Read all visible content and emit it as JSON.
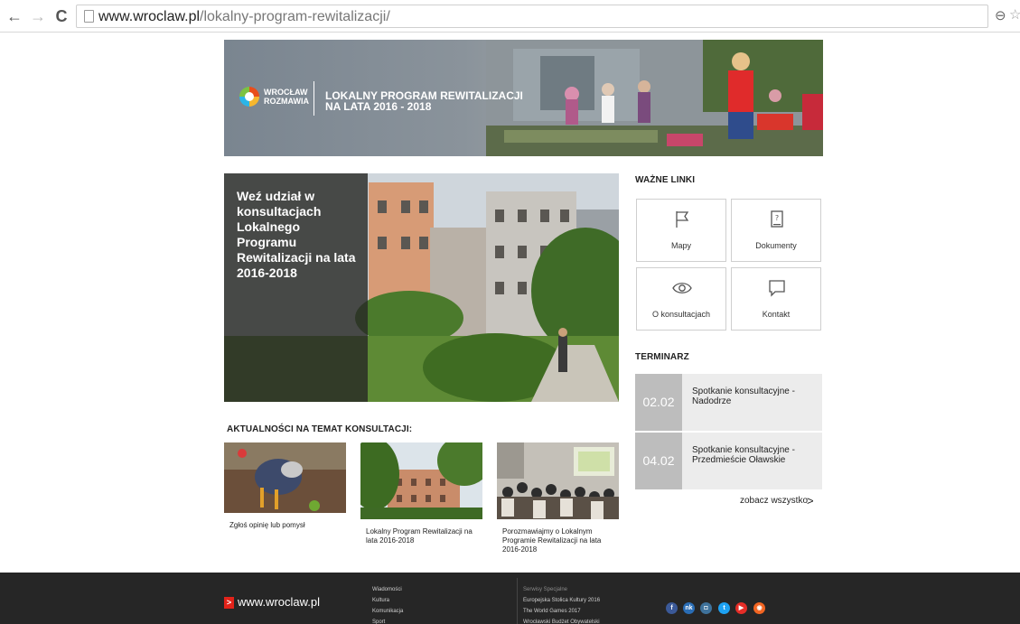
{
  "browser": {
    "url_host": "www.wroclaw.pl",
    "url_path": "/lokalny-program-rewitalizacji/"
  },
  "banner": {
    "logo_line1": "WROCŁAW",
    "logo_line2": "ROZMAWIA",
    "title_line1": "LOKALNY PROGRAM REWITALIZACJI",
    "title_line2": "NA LATA 2016 - 2018"
  },
  "hero": {
    "text": "Weź udział w konsultacjach Lokalnego Programu Rewitalizacji na lata 2016-2018"
  },
  "links": {
    "heading": "WAŻNE LINKI",
    "items": [
      {
        "label": "Mapy",
        "icon": "flag-icon"
      },
      {
        "label": "Dokumenty",
        "icon": "document-icon"
      },
      {
        "label": "O konsultacjach",
        "icon": "eye-icon"
      },
      {
        "label": "Kontakt",
        "icon": "speech-bubble-icon"
      }
    ]
  },
  "calendar": {
    "heading": "TERMINARZ",
    "events": [
      {
        "date": "02.02",
        "title": "Spotkanie konsultacyjne - Nadodrze"
      },
      {
        "date": "04.02",
        "title": "Spotkanie konsultacyjne - Przedmieście Oławskie"
      }
    ],
    "see_all": "zobacz wszystko",
    "see_all_arrow": ">"
  },
  "news": {
    "heading": "AKTUALNOŚCI NA TEMAT KONSULTACJI:",
    "items": [
      {
        "caption": "Zgłoś opinię lub pomysł"
      },
      {
        "caption": "Lokalny Program Rewitalizacji na lata 2016-2018"
      },
      {
        "caption": "Porozmawiajmy o Lokalnym Programie Rewitalizacji na lata 2016-2018"
      }
    ]
  },
  "footer": {
    "logo_mark": ">",
    "logo_text": "www.wroclaw.pl",
    "col1": [
      "Wiadomości",
      "Kultura",
      "Komunikacja",
      "Sport"
    ],
    "col2_heading": "Serwisy Specjalne",
    "col2": [
      "Europejska Stolica Kultury 2016",
      "The World Games 2017",
      "Wrocławski Budżet Obywatelski"
    ],
    "social": [
      {
        "icon": "facebook-icon",
        "glyph": "f",
        "color": "#3b5998"
      },
      {
        "icon": "nk-icon",
        "glyph": "nk",
        "color": "#2a6db5"
      },
      {
        "icon": "instagram-icon",
        "glyph": "◘",
        "color": "#3f729b"
      },
      {
        "icon": "twitter-icon",
        "glyph": "t",
        "color": "#1da1f2"
      },
      {
        "icon": "youtube-icon",
        "glyph": "▶",
        "color": "#e52d27"
      },
      {
        "icon": "rss-icon",
        "glyph": "◉",
        "color": "#f26522"
      }
    ]
  }
}
